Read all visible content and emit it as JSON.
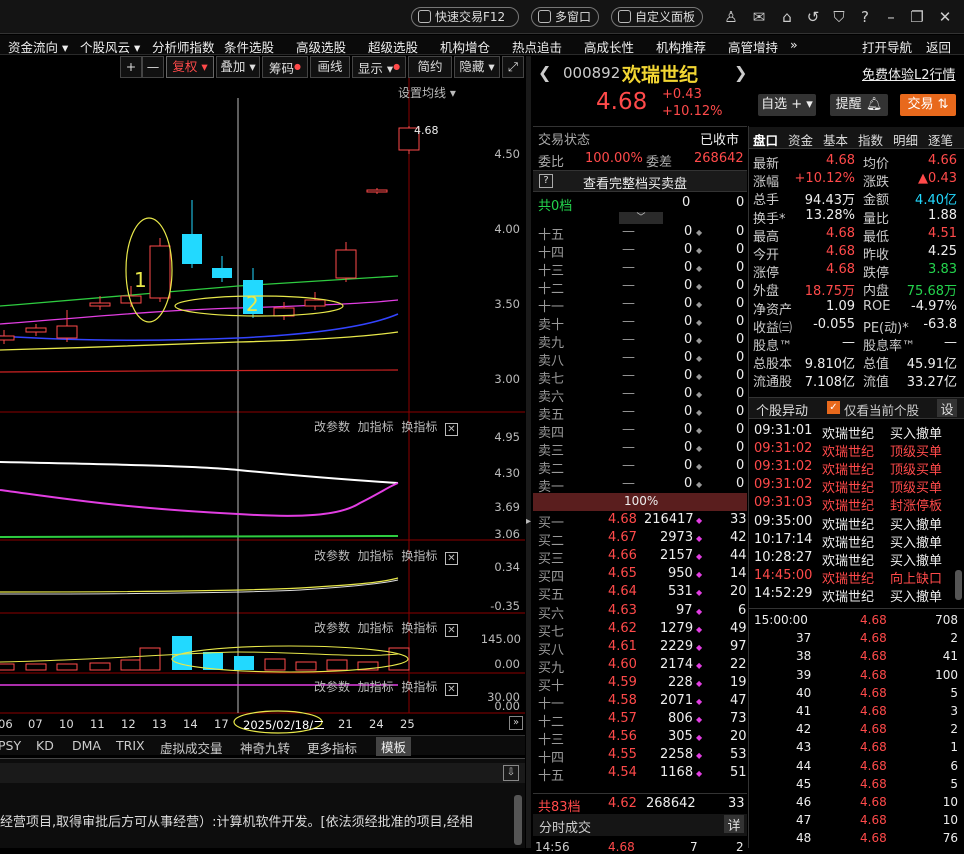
{
  "top": {
    "fast_trade": "快速交易F12",
    "multi_window": "多窗口",
    "custom_panel": "自定义面板"
  },
  "menu": [
    "资金流向 ▾",
    "个股风云 ▾",
    "分析师指数",
    "条件选股",
    "高级选股",
    "超级选股",
    "机构增仓",
    "热点追击",
    "高成长性",
    "机构推荐",
    "高管增持",
    "»",
    "打开导航",
    "返回"
  ],
  "toolbar": {
    "plus": "+",
    "minus": "—",
    "fuquan": "复权",
    "diejia": "叠加",
    "chouma": "筹码",
    "huaxian": "画线",
    "xianshi": "显示",
    "jianyue": "简约",
    "yincang": "隐藏",
    "ma_settings": "设置均线 ▾"
  },
  "price_axis": [
    "4.50",
    "4.00",
    "3.50",
    "3.00"
  ],
  "last_label": "4.68",
  "annot": [
    "1",
    "2"
  ],
  "sub_controls": {
    "a": "改参数",
    "b": "加指标",
    "c": "换指标"
  },
  "sub1_axis": [
    "4.95",
    "4.30",
    "3.69",
    "3.06"
  ],
  "sub2_axis": [
    "0.34",
    "-0.35"
  ],
  "sub3_axis": [
    "145.00",
    "0.00"
  ],
  "sub4_axis": [
    "30.00",
    "0.00"
  ],
  "dates": [
    "06",
    "07",
    "10",
    "11",
    "12",
    "13",
    "14",
    "17",
    "2025/02/18/二",
    "21",
    "24",
    "25"
  ],
  "indicator_tabs": [
    "PSY",
    "KD",
    "DMA",
    "TRIX",
    "虚拟成交量",
    "神奇九转",
    "更多指标",
    "模板"
  ],
  "info_text": "经营项目,取得审批后方可从事经营）:计算机软件开发。[依法须经批准的项目,经相",
  "stock": {
    "code": "000892",
    "name": "欢瑞世纪",
    "price": "4.68",
    "change": "+0.43",
    "pct": "+10.12%",
    "free_l2": "免费体验L2行情",
    "zixuan": "自选 +",
    "tixing": "提醒",
    "jiaoyi": "交易"
  },
  "status": {
    "label": "交易状态",
    "value": "已收市",
    "webi_l": "委比",
    "webi": "100.00%",
    "weicha_l": "委差",
    "weicha": "268642",
    "full": "查看完整档买卖盘",
    "gong_l": "共0档",
    "gong_a": "0",
    "gong_b": "0"
  },
  "sells": [
    {
      "l": "十五"
    },
    {
      "l": "十四"
    },
    {
      "l": "十三"
    },
    {
      "l": "十二"
    },
    {
      "l": "十一"
    },
    {
      "l": "卖十"
    },
    {
      "l": "卖九"
    },
    {
      "l": "卖八"
    },
    {
      "l": "卖七"
    },
    {
      "l": "卖六"
    },
    {
      "l": "卖五"
    },
    {
      "l": "卖四"
    },
    {
      "l": "卖三"
    },
    {
      "l": "卖二"
    },
    {
      "l": "卖一"
    }
  ],
  "sell_blank": {
    "p": "—",
    "v": "0",
    "n": "0"
  },
  "ratio": "100%",
  "buys": [
    {
      "l": "买一",
      "p": "4.68",
      "v": "216417",
      "n": "33"
    },
    {
      "l": "买二",
      "p": "4.67",
      "v": "2973",
      "n": "42"
    },
    {
      "l": "买三",
      "p": "4.66",
      "v": "2157",
      "n": "44"
    },
    {
      "l": "买四",
      "p": "4.65",
      "v": "950",
      "n": "14"
    },
    {
      "l": "买五",
      "p": "4.64",
      "v": "531",
      "n": "20"
    },
    {
      "l": "买六",
      "p": "4.63",
      "v": "97",
      "n": "6"
    },
    {
      "l": "买七",
      "p": "4.62",
      "v": "1279",
      "n": "49"
    },
    {
      "l": "买八",
      "p": "4.61",
      "v": "2229",
      "n": "97"
    },
    {
      "l": "买九",
      "p": "4.60",
      "v": "2174",
      "n": "22"
    },
    {
      "l": "买十",
      "p": "4.59",
      "v": "228",
      "n": "19"
    },
    {
      "l": "十一",
      "p": "4.58",
      "v": "2071",
      "n": "47"
    },
    {
      "l": "十二",
      "p": "4.57",
      "v": "806",
      "n": "73"
    },
    {
      "l": "十三",
      "p": "4.56",
      "v": "305",
      "n": "20"
    },
    {
      "l": "十四",
      "p": "4.55",
      "v": "2258",
      "n": "53"
    },
    {
      "l": "十五",
      "p": "4.54",
      "v": "1168",
      "n": "51"
    }
  ],
  "buy_total": {
    "l": "共83档",
    "p": "4.62",
    "v": "268642",
    "n": "33"
  },
  "fenshi": {
    "label": "分时成交",
    "detail": "详",
    "row": [
      "14:56",
      "4.68",
      "7",
      "2"
    ]
  },
  "tabs": [
    "盘口",
    "资金",
    "基本",
    "指数",
    "明细",
    "逐笔"
  ],
  "stats": [
    [
      "最新",
      "4.68",
      "均价",
      "4.66"
    ],
    [
      "涨幅",
      "+10.12%",
      "涨跌",
      "▲0.43"
    ],
    [
      "总手",
      "94.43万",
      "金额",
      "4.40亿"
    ],
    [
      "换手*",
      "13.28%",
      "量比",
      "1.88"
    ],
    [
      "最高",
      "4.68",
      "最低",
      "4.51"
    ],
    [
      "今开",
      "4.68",
      "昨收",
      "4.25"
    ],
    [
      "涨停",
      "4.68",
      "跌停",
      "3.83"
    ],
    [
      "外盘",
      "18.75万",
      "内盘",
      "75.68万"
    ],
    [
      "净资产",
      "1.09",
      "ROE",
      "-4.97%"
    ],
    [
      "收益㈢",
      "-0.055",
      "PE(动)*",
      "-63.8"
    ],
    [
      "股息™",
      "—",
      "股息率™",
      "—"
    ],
    [
      "总股本",
      "9.810亿",
      "总值",
      "45.91亿"
    ],
    [
      "流通股",
      "7.108亿",
      "流值",
      "33.27亿"
    ]
  ],
  "events_header": {
    "title": "个股异动",
    "only": "仅看当前个股",
    "set": "设"
  },
  "events": [
    [
      "09:31:01",
      "欢瑞世纪",
      "买入撤单",
      "w"
    ],
    [
      "09:31:02",
      "欢瑞世纪",
      "顶级买单",
      "r"
    ],
    [
      "09:31:02",
      "欢瑞世纪",
      "顶级买单",
      "r"
    ],
    [
      "09:31:02",
      "欢瑞世纪",
      "顶级买单",
      "r"
    ],
    [
      "09:31:03",
      "欢瑞世纪",
      "封涨停板",
      "r"
    ],
    [
      "09:35:00",
      "欢瑞世纪",
      "买入撤单",
      "w"
    ],
    [
      "10:17:14",
      "欢瑞世纪",
      "买入撤单",
      "w"
    ],
    [
      "10:28:27",
      "欢瑞世纪",
      "买入撤单",
      "w"
    ],
    [
      "14:45:00",
      "欢瑞世纪",
      "向上缺口",
      "r"
    ],
    [
      "14:52:29",
      "欢瑞世纪",
      "买入撤单",
      "w"
    ]
  ],
  "trades": [
    [
      "15:00:00",
      "4.68",
      "708"
    ],
    [
      "37",
      "4.68",
      "2"
    ],
    [
      "38",
      "4.68",
      "41"
    ],
    [
      "39",
      "4.68",
      "100"
    ],
    [
      "40",
      "4.68",
      "5"
    ],
    [
      "41",
      "4.68",
      "3"
    ],
    [
      "42",
      "4.68",
      "2"
    ],
    [
      "43",
      "4.68",
      "1"
    ],
    [
      "44",
      "4.68",
      "6"
    ],
    [
      "45",
      "4.68",
      "5"
    ],
    [
      "46",
      "4.68",
      "10"
    ],
    [
      "47",
      "4.68",
      "10"
    ],
    [
      "48",
      "4.68",
      "76"
    ]
  ]
}
